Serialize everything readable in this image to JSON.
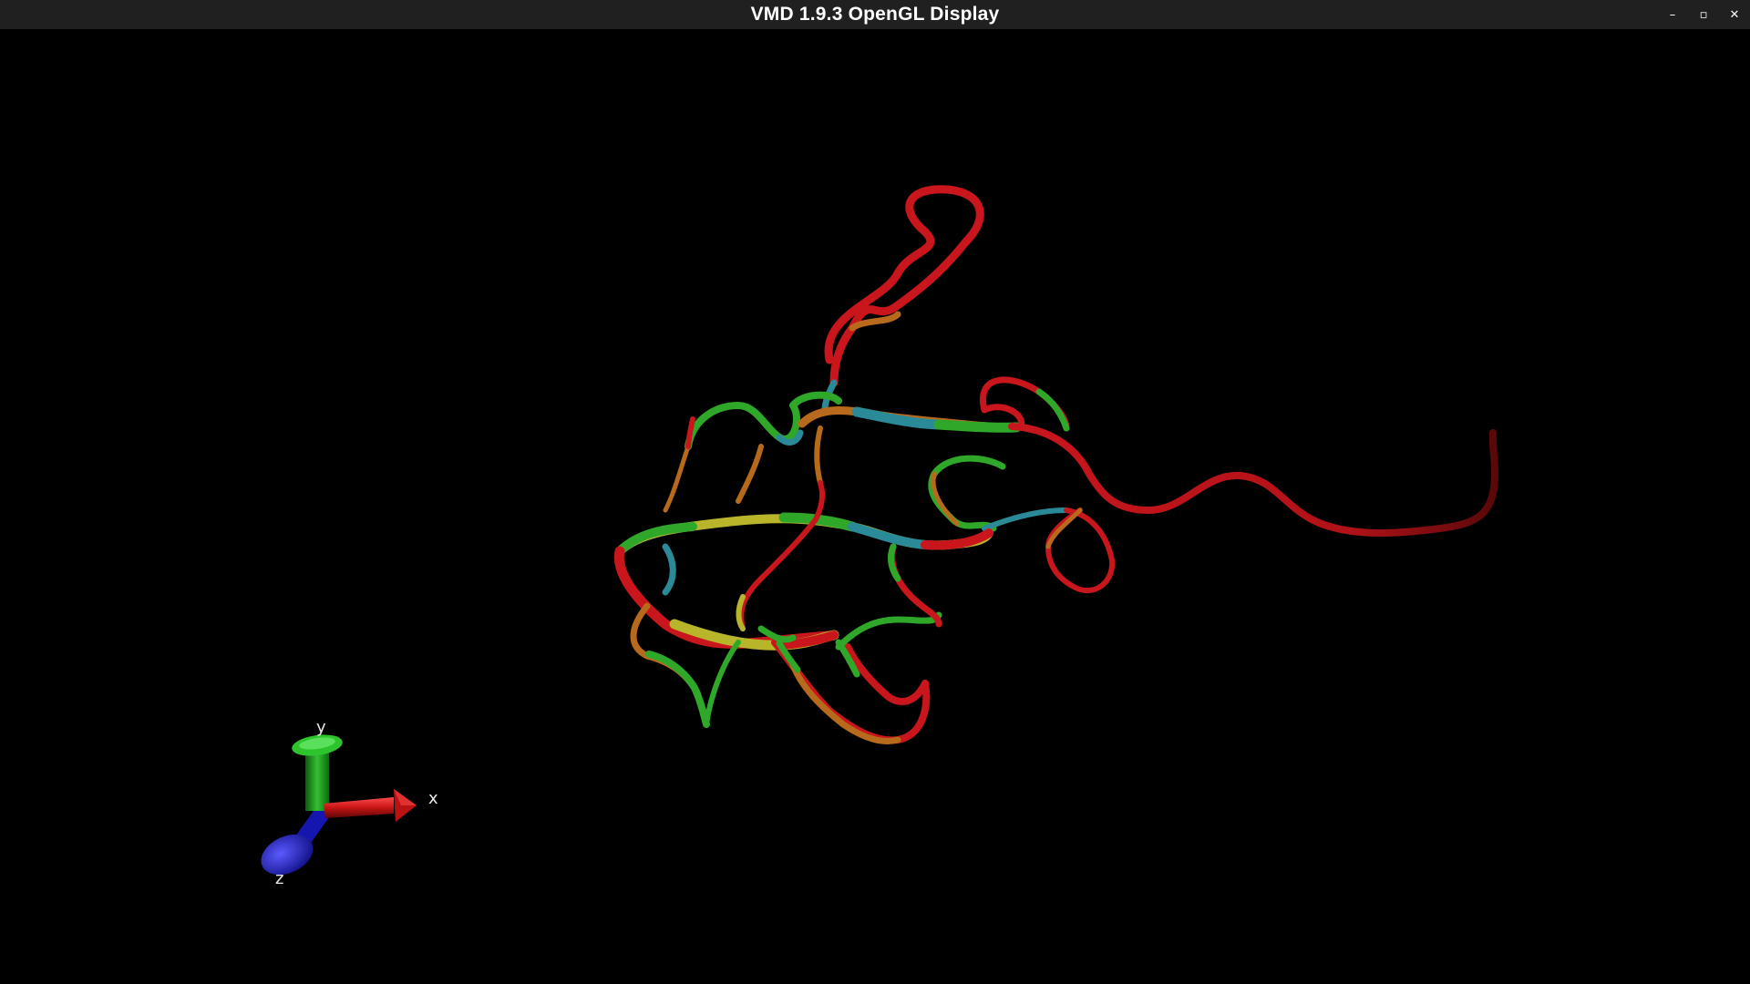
{
  "window": {
    "title": "VMD 1.9.3 OpenGL Display",
    "controls": {
      "minimize_glyph": "–",
      "maximize_glyph": "▫",
      "close_glyph": "✕"
    }
  },
  "axes": {
    "x_label": "x",
    "y_label": "y",
    "z_label": "z"
  },
  "colors": {
    "background": "#000000",
    "titlebar": "#202020",
    "ribbon_red": "#c8161c",
    "ribbon_green": "#2fa82a",
    "ribbon_yellow": "#b9b52a",
    "ribbon_teal": "#2a8a98",
    "ribbon_orange": "#b86a1c",
    "axis_x": "#cc1515",
    "axis_y": "#1b9a1b",
    "axis_z": "#1a1ad8"
  }
}
